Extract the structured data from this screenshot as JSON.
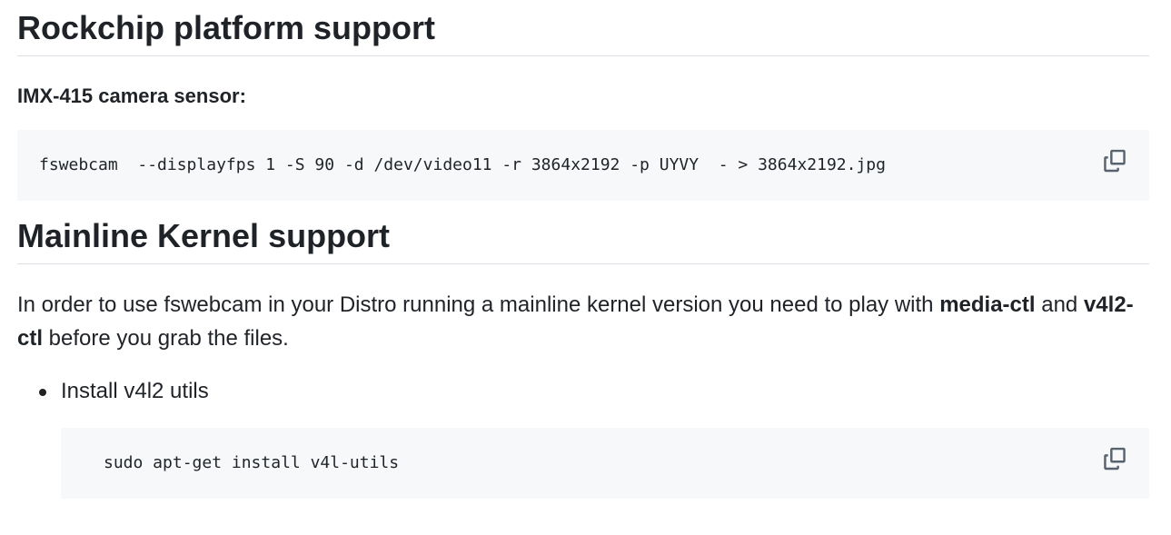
{
  "sections": {
    "rockchip_heading": "Rockchip platform support",
    "imx_subheading": "IMX-415 camera sensor:",
    "imx_code": "fswebcam  --displayfps 1 -S 90 -d /dev/video11 -r 3864x2192 -p UYVY  - > 3864x2192.jpg",
    "mainline_heading": "Mainline Kernel support",
    "paragraph": {
      "part1": "In order to use fswebcam in your Distro running a mainline kernel version you need to play with ",
      "bold1": "media-ctl",
      "part2": " and ",
      "bold2": "v4l2-ctl",
      "part3": " before you grab the files."
    },
    "list": {
      "item1": "Install v4l2 utils"
    },
    "utils_code": "sudo apt-get install v4l-utils"
  },
  "icons": {
    "copy": "copy-icon"
  },
  "colors": {
    "text": "#1f2328",
    "code_bg": "#f6f8fa",
    "divider": "#d8dee4",
    "icon": "#59636e"
  }
}
